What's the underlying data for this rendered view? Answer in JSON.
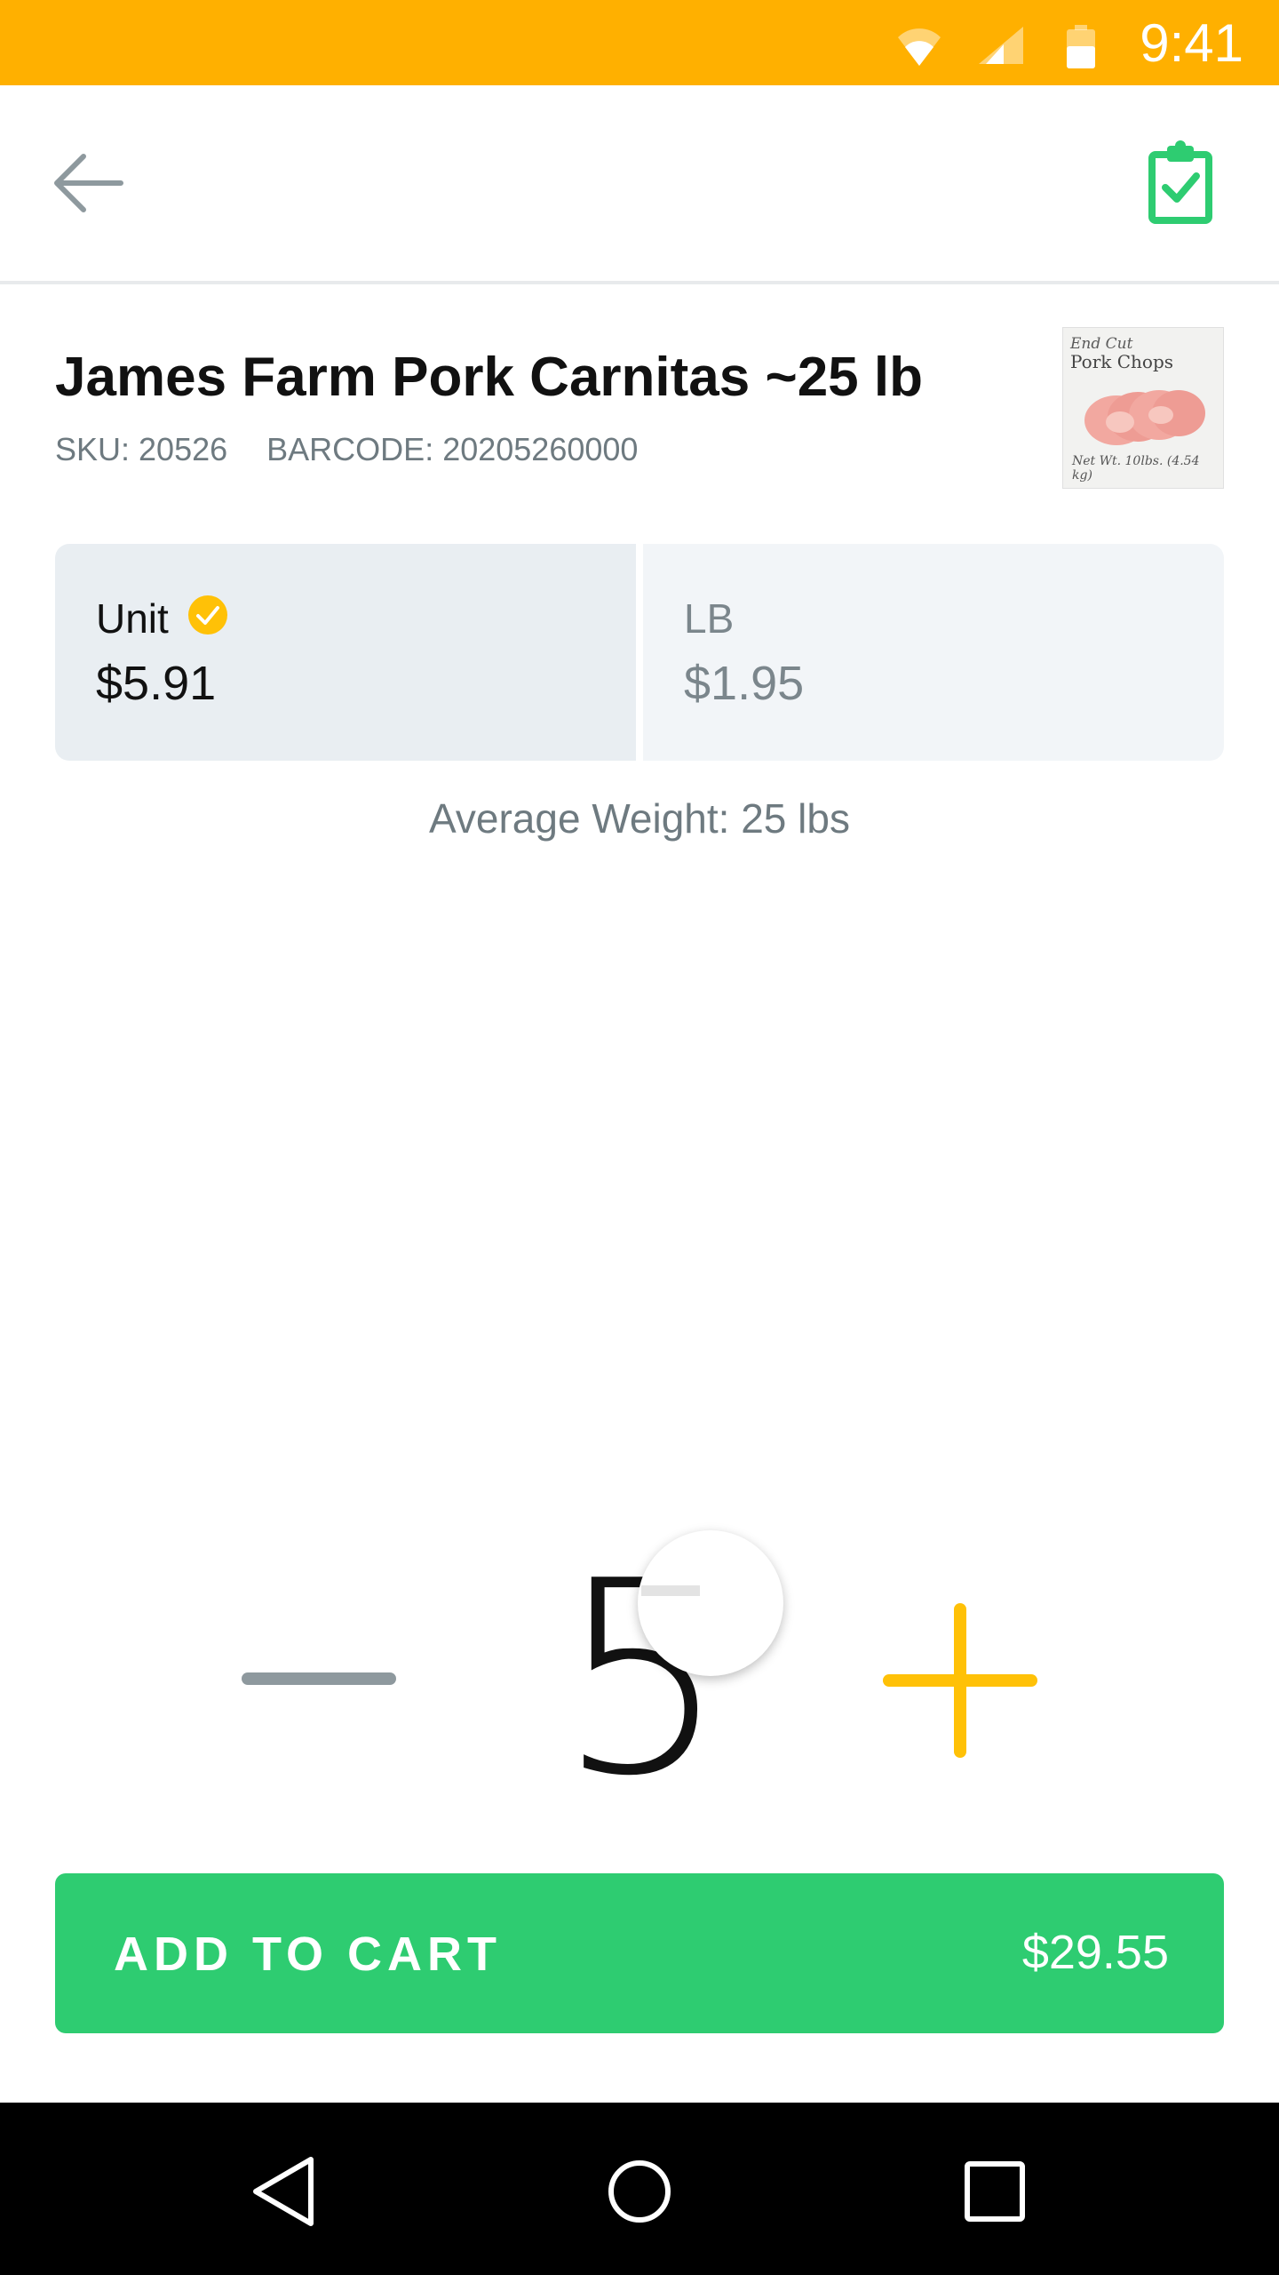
{
  "status_bar": {
    "time": "9:41",
    "icons": [
      "wifi-icon",
      "signal-icon",
      "battery-icon"
    ],
    "color": "#FFB000"
  },
  "app_bar": {
    "back_icon": "arrow-left-icon",
    "action_icon": "clipboard-check-icon",
    "action_color": "#2ECC71"
  },
  "product": {
    "title": "James Farm Pork Carnitas ~25 lb",
    "sku": "SKU: 20526",
    "barcode": "BARCODE: 20205260000",
    "thumbnail": {
      "line1": "End Cut",
      "line2": "Pork Chops",
      "line3": "Net Wt. 10lbs. (4.54 kg)"
    }
  },
  "pricing": {
    "options": [
      {
        "label": "Unit",
        "price": "$5.91",
        "selected": true
      },
      {
        "label": "LB",
        "price": "$1.95",
        "selected": false
      }
    ],
    "selected_icon": "check-circle-icon",
    "accent": "#FFC107"
  },
  "average_weight": "Average Weight: 25 lbs",
  "quantity": {
    "value": "5",
    "decrement_icon": "minus-icon",
    "increment_icon": "plus-icon"
  },
  "cart": {
    "label": "ADD TO CART",
    "total": "$29.55",
    "color": "#2ECC71"
  },
  "nav_bar": {
    "icons": [
      "nav-back-icon",
      "nav-home-icon",
      "nav-recents-icon"
    ]
  }
}
